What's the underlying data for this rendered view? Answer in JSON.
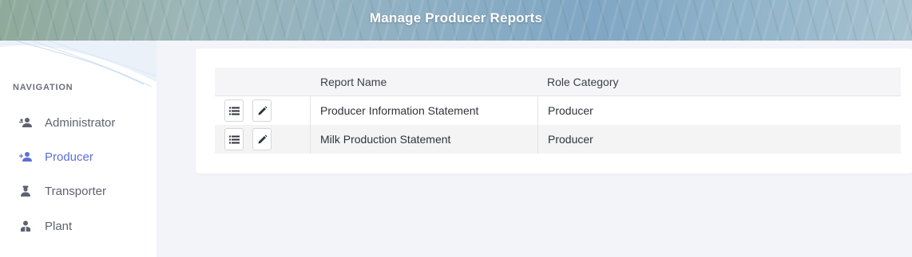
{
  "header": {
    "title": "Manage Producer Reports"
  },
  "sidebar": {
    "heading": "NAVIGATION",
    "items": [
      {
        "label": "Administrator",
        "icon": "user-group-icon",
        "active": false
      },
      {
        "label": "Producer",
        "icon": "user-plus-icon",
        "active": true
      },
      {
        "label": "Transporter",
        "icon": "driver-icon",
        "active": false
      },
      {
        "label": "Plant",
        "icon": "worker-icon",
        "active": false
      }
    ]
  },
  "table": {
    "columns": [
      "",
      "Report Name",
      "Role Category"
    ],
    "rows": [
      {
        "report_name": "Producer Information Statement",
        "role_category": "Producer"
      },
      {
        "report_name": "Milk Production Statement",
        "role_category": "Producer"
      }
    ],
    "row_actions": [
      "list-icon",
      "edit-pencil-icon"
    ]
  },
  "colors": {
    "accent": "#5b6fd6",
    "sidebar_text": "#5d6371",
    "page_background": "#f3f4f9"
  }
}
